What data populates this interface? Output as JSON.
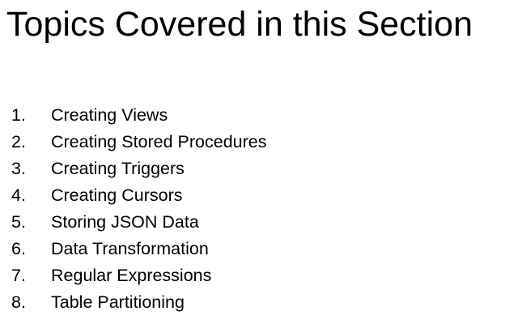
{
  "slide": {
    "title": "Topics Covered in this Section",
    "topics": [
      {
        "number": "1.",
        "label": "Creating Views"
      },
      {
        "number": "2.",
        "label": "Creating Stored Procedures"
      },
      {
        "number": "3.",
        "label": "Creating Triggers"
      },
      {
        "number": "4.",
        "label": "Creating Cursors"
      },
      {
        "number": "5.",
        "label": "Storing JSON Data"
      },
      {
        "number": "6.",
        "label": "Data Transformation"
      },
      {
        "number": "7.",
        "label": "Regular Expressions"
      },
      {
        "number": "8.",
        "label": "Table Partitioning"
      }
    ]
  }
}
